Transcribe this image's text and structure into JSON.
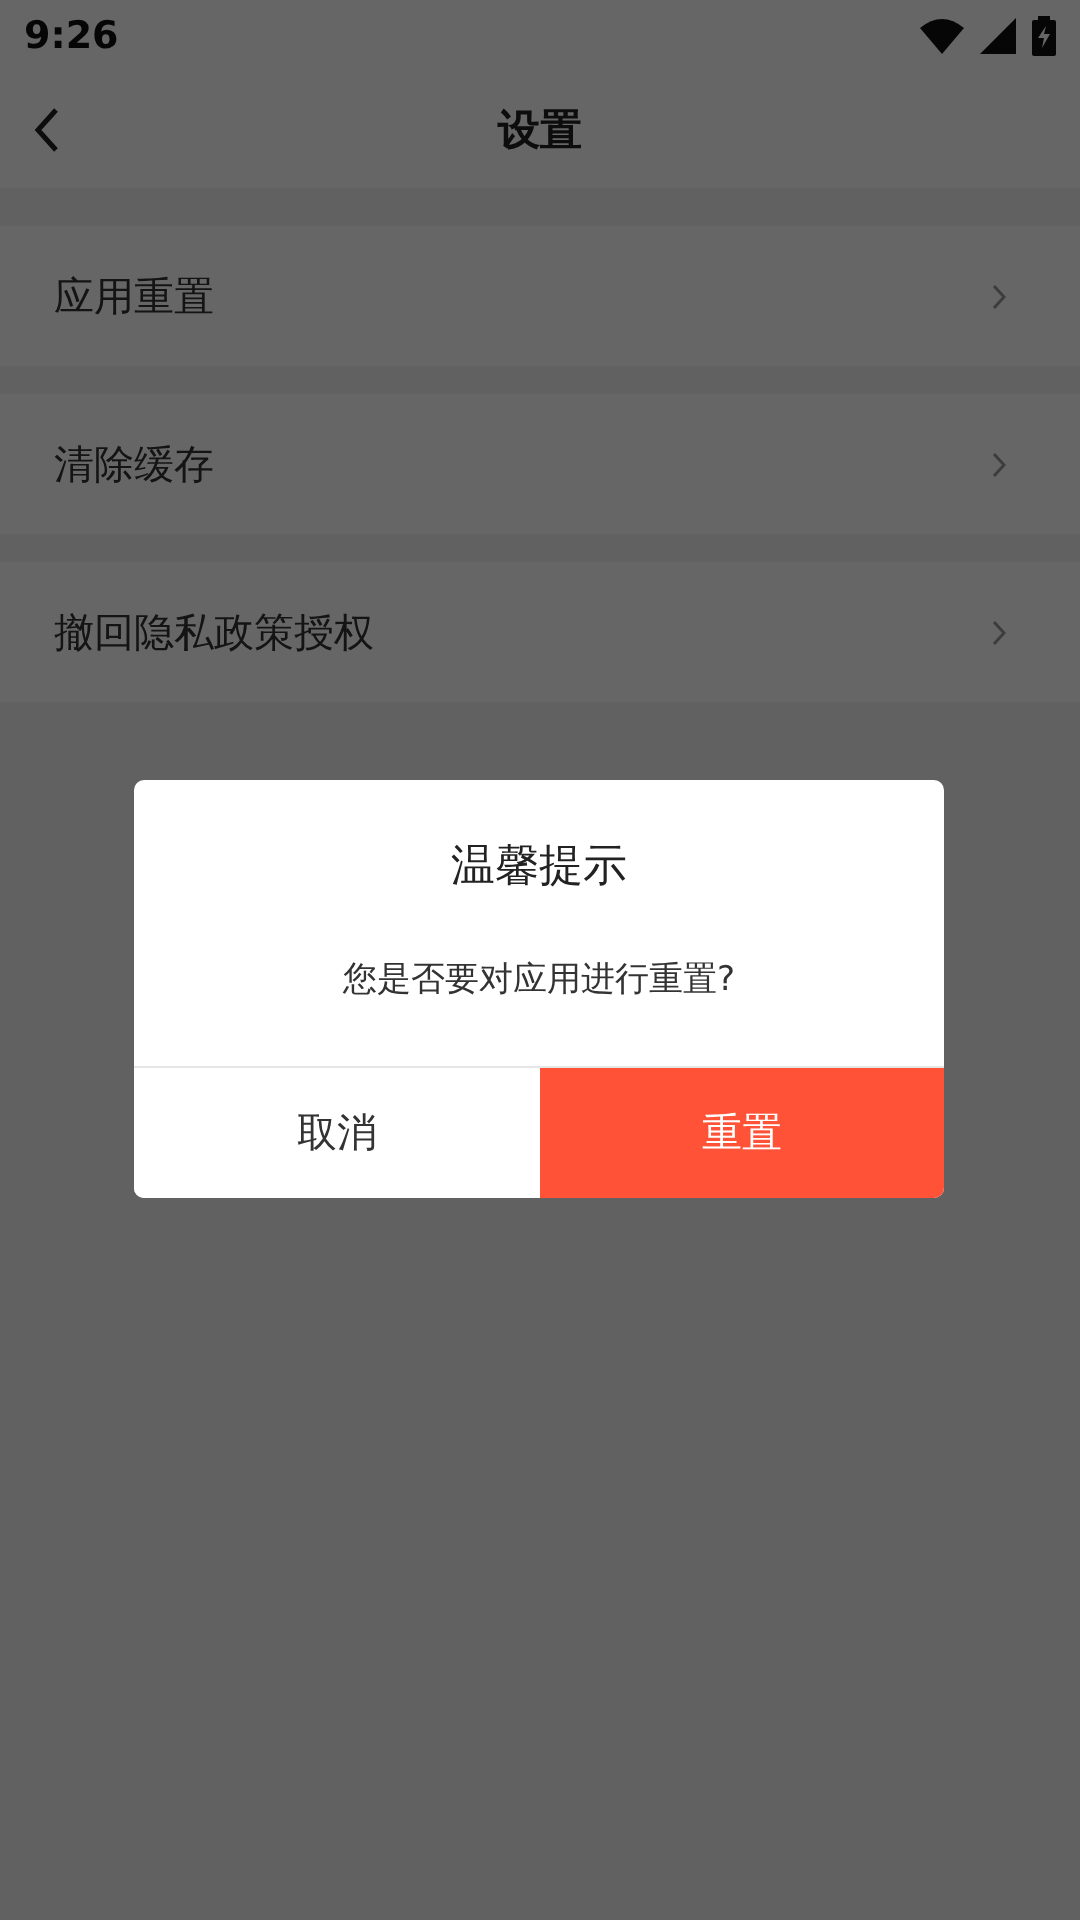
{
  "status_bar": {
    "time": "9:26"
  },
  "header": {
    "title": "设置"
  },
  "settings": [
    {
      "label": "应用重置"
    },
    {
      "label": "清除缓存"
    },
    {
      "label": "撤回隐私政策授权"
    }
  ],
  "dialog": {
    "title": "温馨提示",
    "message": "您是否要对应用进行重置?",
    "buttons": [
      {
        "label": "取消",
        "kind": "cancel"
      },
      {
        "label": "重置",
        "kind": "confirm"
      }
    ]
  }
}
